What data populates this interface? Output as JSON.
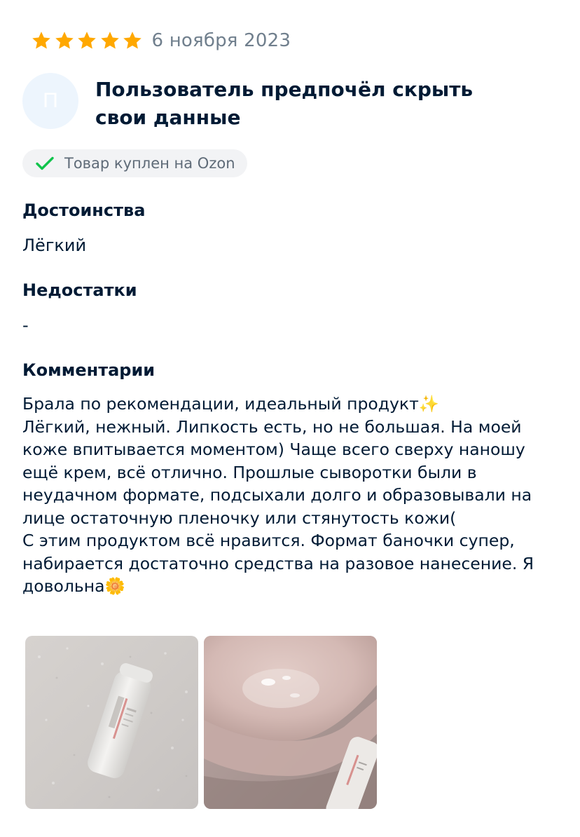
{
  "review": {
    "rating": 5,
    "max_rating": 5,
    "date": "6 ноября 2023",
    "colors": {
      "star": "#ffa800",
      "check": "#10c44c",
      "text": "#001a34",
      "muted": "#707f8d",
      "badge_bg": "#f2f3f5",
      "avatar_bg": "#edf5fd"
    }
  },
  "author": {
    "initial": "П",
    "name": "Пользователь предпочёл скрыть свои данные"
  },
  "badge": {
    "icon": "check-icon",
    "text": "Товар куплен на Ozon"
  },
  "pros": {
    "title": "Достоинства",
    "text": "Лёгкий"
  },
  "cons": {
    "title": "Недостатки",
    "text": "-"
  },
  "comment": {
    "title": "Комментарии",
    "text": "Брала по рекомендации, идеальный продукт✨\nЛёгкий, нежный. Липкость есть, но не большая. На моей коже впитывается моментом) Чаще всего сверху наношу ещё крем, всё отлично. Прошлые сыворотки были в неудачном формате, подсыхали долго и образовывали на лице остаточную пленочку или стянутость кожи(\nС этим продуктом всё нравится. Формат баночки супер, набирается достаточно средства на разовое нанесение. Я довольна🌼"
  },
  "photos": [
    {
      "subject": "serum-bottle-on-towel"
    },
    {
      "subject": "serum-on-hand"
    }
  ]
}
